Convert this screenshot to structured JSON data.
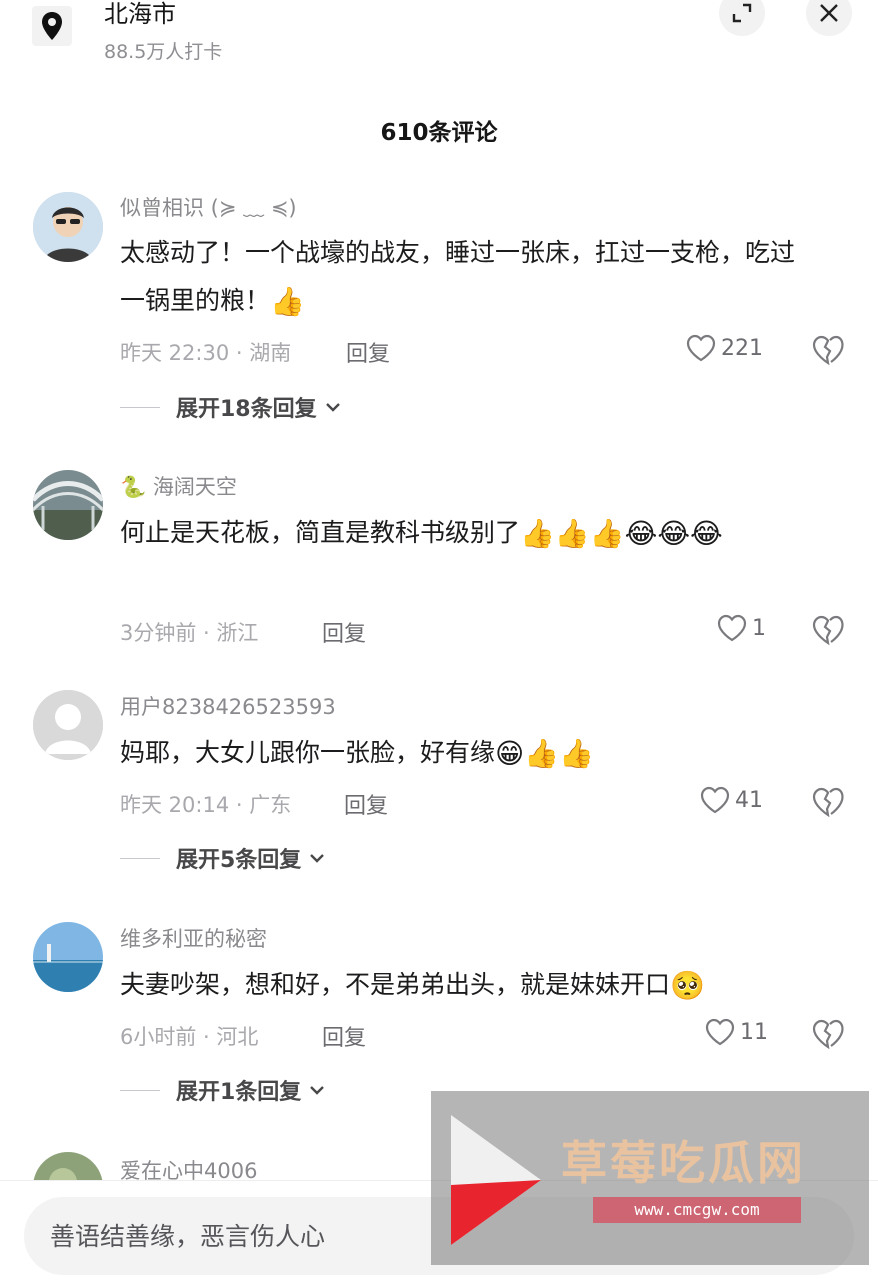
{
  "header": {
    "location_name": "北海市",
    "checkins": "88.5万人打卡",
    "comment_count": "610条评论"
  },
  "comments": [
    {
      "username": "似曾相识 (≽ ﹏ ≼)",
      "text": "太感动了！一个战壕的战友，睡过一张床，扛过一支枪，吃过一锅里的粮！",
      "emojis": "👍",
      "time_location": "昨天 22:30 · 湖南",
      "reply_label": "回复",
      "likes": "221",
      "expand_replies": "展开18条回复"
    },
    {
      "username": "海阔天空",
      "username_emoji": "🐍",
      "text": "何止是天花板，简直是教科书级别了",
      "emojis": "👍👍👍😂😂😂",
      "time_location": "3分钟前 · 浙江",
      "reply_label": "回复",
      "likes": "1"
    },
    {
      "username": "用户8238426523593",
      "text": "妈耶，大女儿跟你一张脸，好有缘",
      "emojis": "😁👍👍",
      "time_location": "昨天 20:14 · 广东",
      "reply_label": "回复",
      "likes": "41",
      "expand_replies": "展开5条回复"
    },
    {
      "username": "维多利亚的秘密",
      "text": "夫妻吵架，想和好，不是弟弟出头，就是妹妹开口",
      "emojis": "🥺",
      "time_location": "6小时前 · 河北",
      "reply_label": "回复",
      "likes": "11",
      "expand_replies": "展开1条回复"
    },
    {
      "username": "爱在心中4006"
    }
  ],
  "input": {
    "placeholder": "善语结善缘，恶言伤人心"
  },
  "watermark": {
    "text": "草莓吃瓜网",
    "url": "www.cmcgw.com"
  },
  "icons": {
    "location": "location-pin-icon",
    "expand": "expand-icon",
    "close": "close-icon",
    "like": "heart-icon",
    "dislike": "broken-heart-icon",
    "chevron": "chevron-down-icon"
  }
}
